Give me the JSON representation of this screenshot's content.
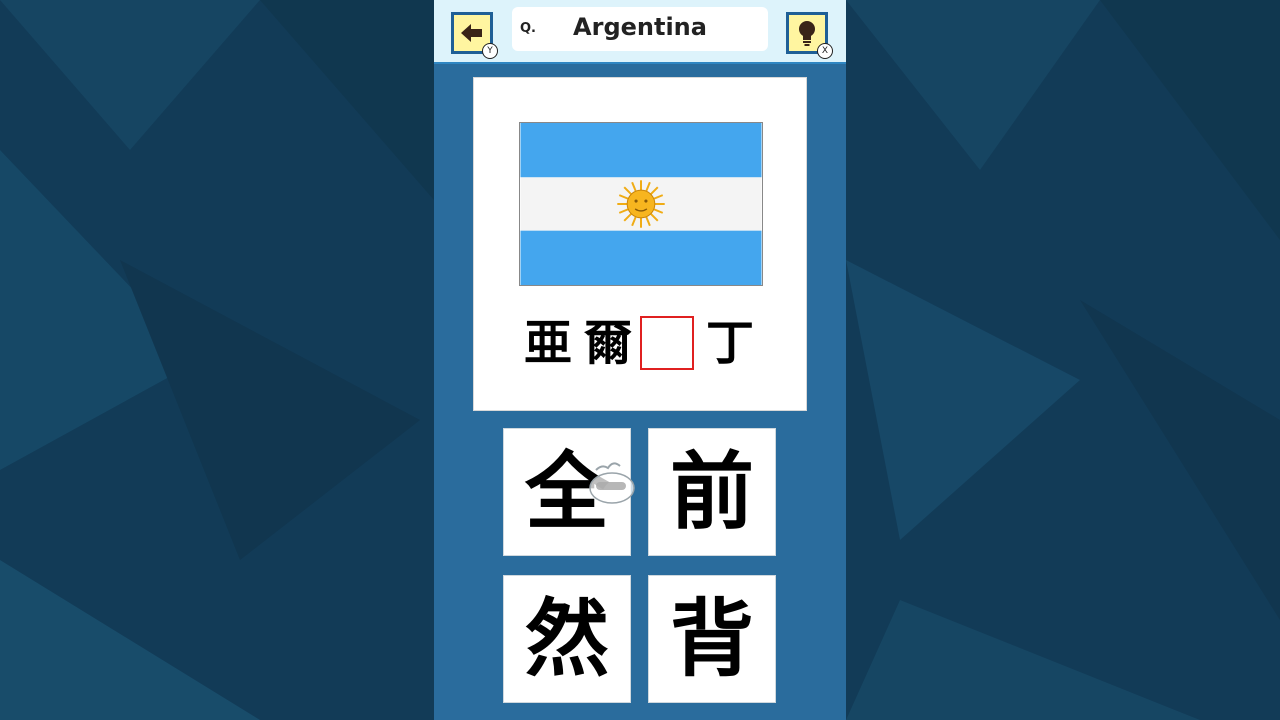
{
  "header": {
    "back_button": {
      "icon": "left-arrow-icon",
      "badge": "Y"
    },
    "question_prefix": "Q.",
    "question_title": "Argentina",
    "hint_button": {
      "icon": "lightbulb-icon",
      "badge": "X"
    }
  },
  "puzzle": {
    "flag": "argentina-flag",
    "word_chars": [
      "亜",
      "爾",
      "",
      "丁"
    ],
    "blank_index": 2
  },
  "choices": [
    {
      "label": "全"
    },
    {
      "label": "前"
    },
    {
      "label": "然"
    },
    {
      "label": "背"
    }
  ],
  "colors": {
    "background": "#123b57",
    "panel": "#2a6c9d",
    "topbar": "#ddf3fb",
    "button_fill": "#fff5a0",
    "flag_blue": "#44a6ee",
    "sun": "#f7b51f",
    "blank_border": "#e02020"
  }
}
